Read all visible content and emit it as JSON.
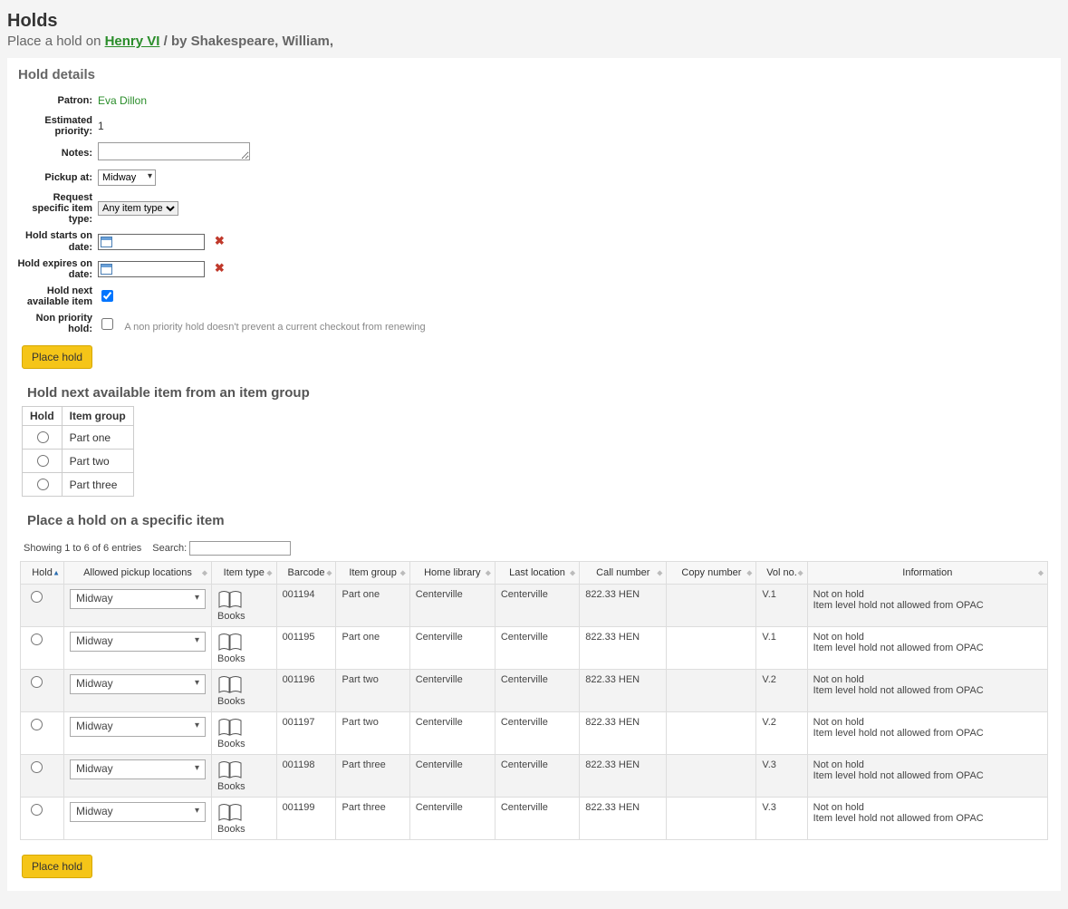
{
  "page_title": "Holds",
  "subhead_prefix": "Place a hold on ",
  "subhead_title": "Henry VI",
  "subhead_after": " / by Shakespeare, William,",
  "hold_details_heading": "Hold details",
  "labels": {
    "patron": "Patron:",
    "priority": "Estimated priority:",
    "notes": "Notes:",
    "pickup": "Pickup at:",
    "itemtype": "Request specific item type:",
    "startdate": "Hold starts on date:",
    "expdate": "Hold expires on date:",
    "nextavail": "Hold next available item",
    "nonpriority": "Non priority hold:"
  },
  "patron_name": "Eva Dillon",
  "priority_value": "1",
  "pickup_selected": "Midway",
  "itemtype_selected": "Any item type",
  "nonpriority_hint": "A non priority hold doesn't prevent a current checkout from renewing",
  "place_hold_label": "Place hold",
  "item_group_heading": "Hold next available item from an item group",
  "item_group_cols": {
    "hold": "Hold",
    "group": "Item group"
  },
  "item_groups": [
    "Part one",
    "Part two",
    "Part three"
  ],
  "specific_heading": "Place a hold on a specific item",
  "showing_text": "Showing 1 to 6 of 6 entries",
  "search_label": "Search:",
  "cols": {
    "hold": "Hold",
    "pickup": "Allowed pickup locations",
    "itype": "Item type",
    "barcode": "Barcode",
    "group": "Item group",
    "home": "Home library",
    "last": "Last location",
    "call": "Call number",
    "copy": "Copy number",
    "vol": "Vol no.",
    "info": "Information"
  },
  "itype_name": "Books",
  "rows": [
    {
      "pickup": "Midway",
      "barcode": "001194",
      "group": "Part one",
      "home": "Centerville",
      "last": "Centerville",
      "call": "822.33 HEN",
      "copy": "",
      "vol": "V.1",
      "info1": "Not on hold",
      "info2": "Item level hold not allowed from OPAC"
    },
    {
      "pickup": "Midway",
      "barcode": "001195",
      "group": "Part one",
      "home": "Centerville",
      "last": "Centerville",
      "call": "822.33 HEN",
      "copy": "",
      "vol": "V.1",
      "info1": "Not on hold",
      "info2": "Item level hold not allowed from OPAC"
    },
    {
      "pickup": "Midway",
      "barcode": "001196",
      "group": "Part two",
      "home": "Centerville",
      "last": "Centerville",
      "call": "822.33 HEN",
      "copy": "",
      "vol": "V.2",
      "info1": "Not on hold",
      "info2": "Item level hold not allowed from OPAC"
    },
    {
      "pickup": "Midway",
      "barcode": "001197",
      "group": "Part two",
      "home": "Centerville",
      "last": "Centerville",
      "call": "822.33 HEN",
      "copy": "",
      "vol": "V.2",
      "info1": "Not on hold",
      "info2": "Item level hold not allowed from OPAC"
    },
    {
      "pickup": "Midway",
      "barcode": "001198",
      "group": "Part three",
      "home": "Centerville",
      "last": "Centerville",
      "call": "822.33 HEN",
      "copy": "",
      "vol": "V.3",
      "info1": "Not on hold",
      "info2": "Item level hold not allowed from OPAC"
    },
    {
      "pickup": "Midway",
      "barcode": "001199",
      "group": "Part three",
      "home": "Centerville",
      "last": "Centerville",
      "call": "822.33 HEN",
      "copy": "",
      "vol": "V.3",
      "info1": "Not on hold",
      "info2": "Item level hold not allowed from OPAC"
    }
  ]
}
